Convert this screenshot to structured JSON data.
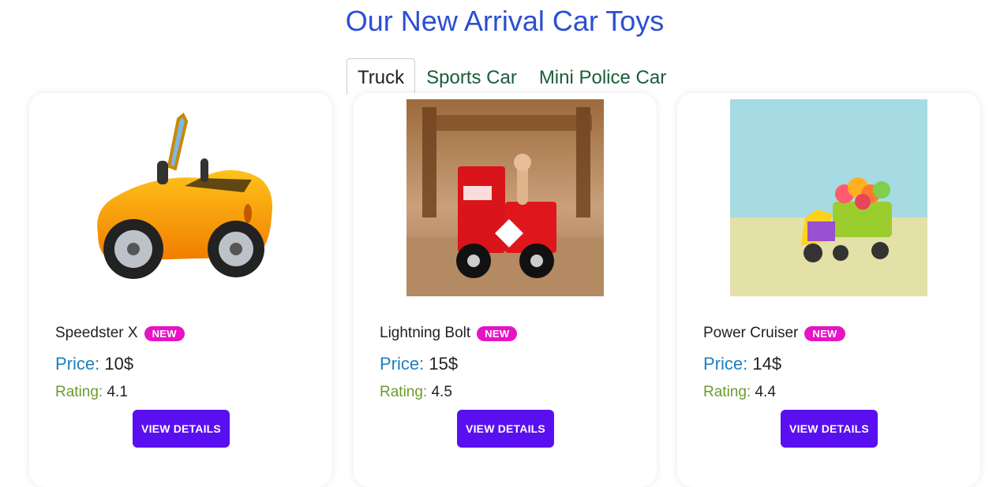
{
  "title": "Our New Arrival Car Toys",
  "tabs": [
    {
      "label": "Truck",
      "active": true
    },
    {
      "label": "Sports Car",
      "active": false
    },
    {
      "label": "Mini Police Car",
      "active": false
    }
  ],
  "cards": [
    {
      "name": "Speedster X",
      "badge": "NEW",
      "price_label": "Price:",
      "price": "10$",
      "rating_label": "Rating:",
      "rating": "4.1",
      "button": "VIEW DETAILS",
      "image": "yellow-convertible-car"
    },
    {
      "name": "Lightning Bolt",
      "badge": "NEW",
      "price_label": "Price:",
      "price": "15$",
      "rating_label": "Rating:",
      "rating": "4.5",
      "button": "VIEW DETAILS",
      "image": "red-wooden-train"
    },
    {
      "name": "Power Cruiser",
      "badge": "NEW",
      "price_label": "Price:",
      "price": "14$",
      "rating_label": "Rating:",
      "rating": "4.4",
      "button": "VIEW DETAILS",
      "image": "yellow-toy-truck-candy"
    }
  ],
  "colors": {
    "title": "#2b4fd1",
    "tab": "#1a5d3a",
    "badge": "#e514c4",
    "button": "#5a0ff0",
    "price_label": "#1f7fbf",
    "rating_label": "#6c9b2e"
  }
}
